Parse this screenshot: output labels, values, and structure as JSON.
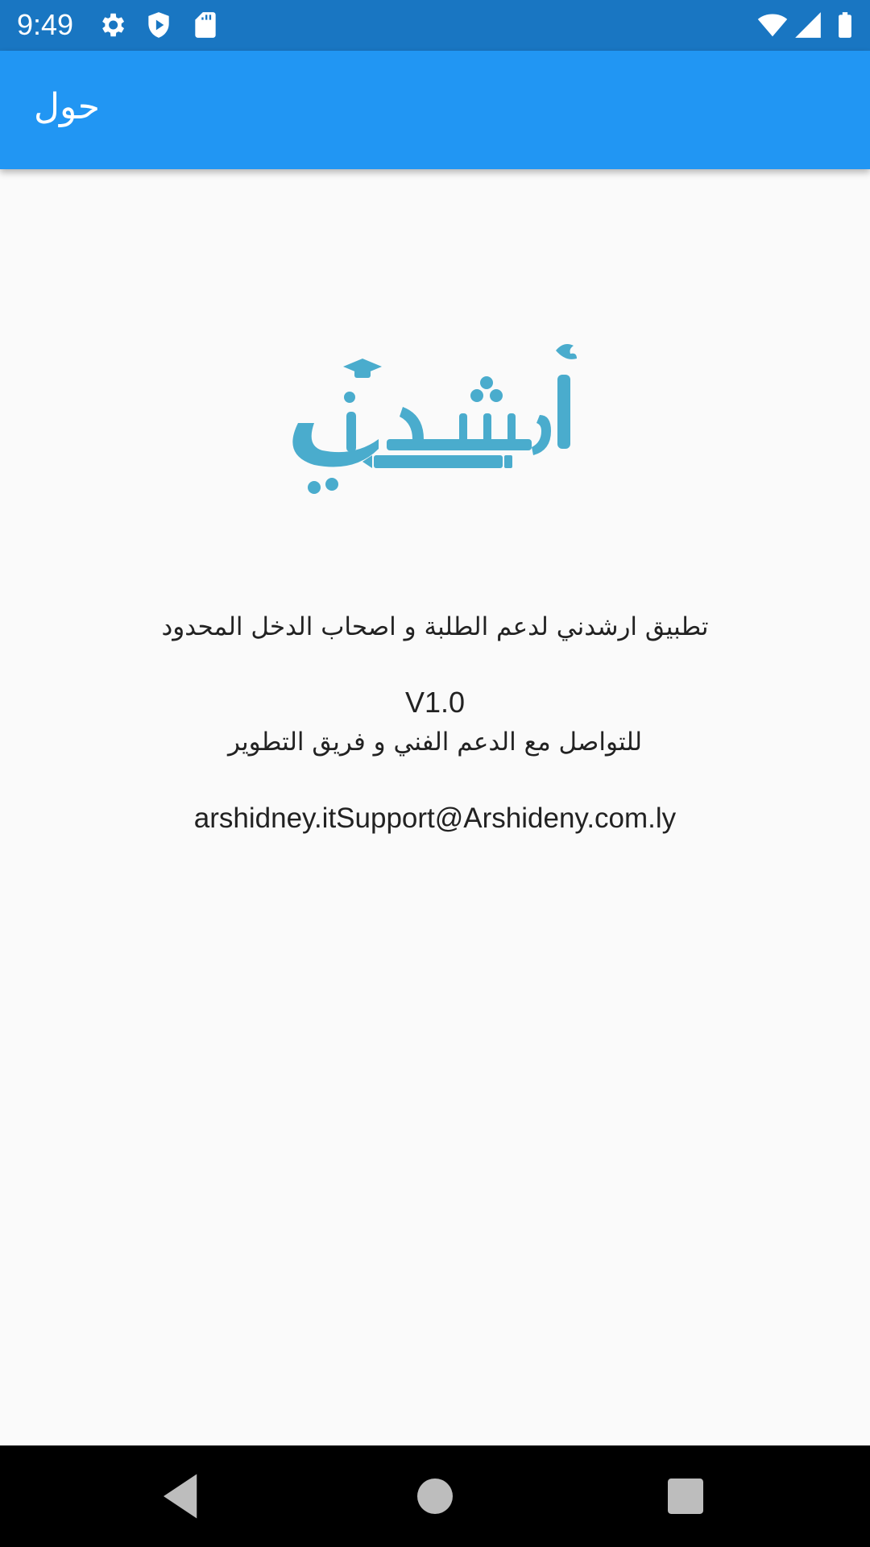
{
  "status_bar": {
    "time": "9:49",
    "background": "#1976c2",
    "icons": [
      "settings-icon",
      "shield-play-icon",
      "sd-card-icon",
      "wifi-icon",
      "signal-icon",
      "battery-icon"
    ]
  },
  "app_bar": {
    "title": "حول",
    "background": "#2196f3"
  },
  "logo": {
    "text": "أرشدني",
    "color": "#4aaccd"
  },
  "content": {
    "description": "تطبيق ارشدني لدعم الطلبة و اصحاب الدخل المحدود",
    "version": "V1.0",
    "contact_label": "للتواصل مع الدعم الفني و فريق التطوير",
    "email": "arshidney.itSupport@Arshideny.com.ly"
  },
  "nav_bar": {
    "buttons": [
      "back-icon",
      "home-icon",
      "recents-icon"
    ]
  }
}
